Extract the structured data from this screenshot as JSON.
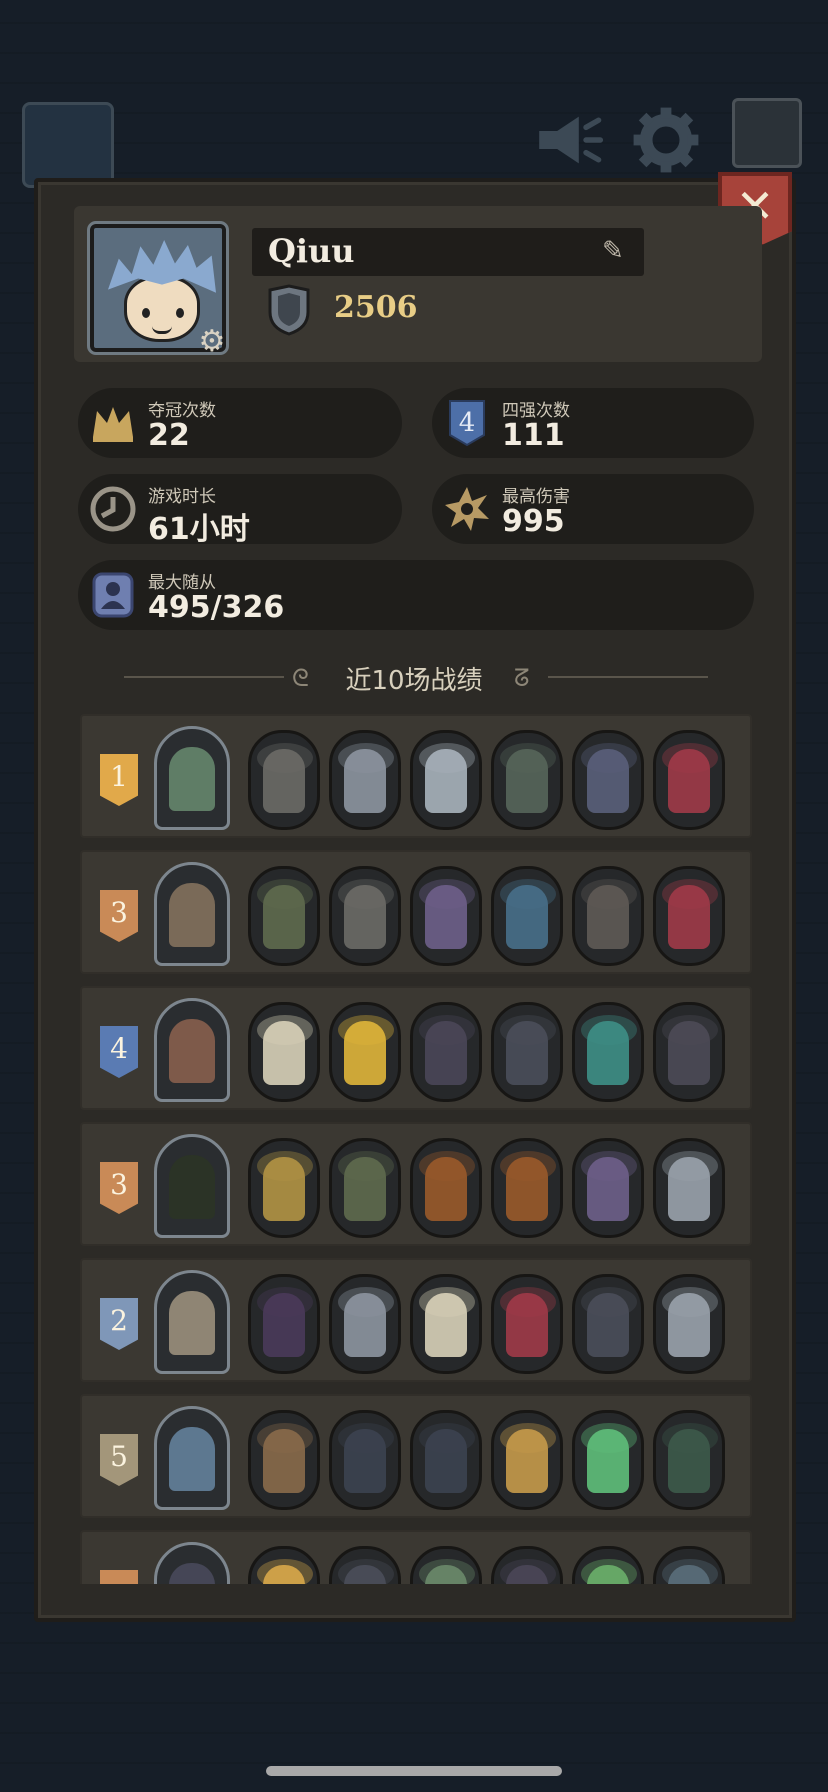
{
  "profile": {
    "name": "Qiuu",
    "rating": "2506"
  },
  "stats": {
    "championships": {
      "label": "夺冠次数",
      "value": "22",
      "icon": "crown-icon"
    },
    "top4": {
      "label": "四强次数",
      "value": "111",
      "icon": "top4-icon"
    },
    "playtime": {
      "label": "游戏时长",
      "value": "61小时",
      "icon": "clock-icon"
    },
    "max_damage": {
      "label": "最高伤害",
      "value": "995",
      "icon": "damage-burst-icon"
    },
    "max_minions": {
      "label": "最大随从",
      "value": "495/326",
      "icon": "minion-icon"
    }
  },
  "history": {
    "title": "近10场战绩",
    "matches": [
      {
        "rank": "1",
        "rank_color": "#e1a94a",
        "hero_color": "#5f7d66",
        "minions": [
          "#6b6a66",
          "#8d95a0",
          "#a9b3bb",
          "#56655a",
          "#5a5f7a",
          "#a03a48"
        ]
      },
      {
        "rank": "3",
        "rank_color": "#c98a57",
        "hero_color": "#7a6a58",
        "minions": [
          "#5f6a4e",
          "#6b6a66",
          "#6e5f8a",
          "#486f8a",
          "#5f5a55",
          "#a03a48"
        ]
      },
      {
        "rank": "4",
        "rank_color": "#5a7bb3",
        "hero_color": "#7e5a4a",
        "minions": [
          "#d8d0b8",
          "#e0b53a",
          "#4a4658",
          "#4a4e5a",
          "#3e8f86",
          "#4c4a56"
        ]
      },
      {
        "rank": "3",
        "rank_color": "#c98a57",
        "hero_color": "#2b3326",
        "minions": [
          "#b39444",
          "#5f6a4e",
          "#9a5a2a",
          "#9a5a2a",
          "#6e5f8a",
          "#9aa2ac"
        ]
      },
      {
        "rank": "2",
        "rank_color": "#7f97b8",
        "hero_color": "#8f8574",
        "minions": [
          "#4a3a5a",
          "#8d95a0",
          "#d8d0b8",
          "#a03a48",
          "#4a4e5a",
          "#9aa2ac"
        ]
      },
      {
        "rank": "5",
        "rank_color": "#a3967a",
        "hero_color": "#5d7890",
        "minions": [
          "#8a6a4a",
          "#3c4250",
          "#3c4250",
          "#c79a4a",
          "#5fbf7a",
          "#3d5a4a"
        ]
      },
      {
        "rank": "",
        "rank_color": "#c98a57",
        "hero_color": "#454656",
        "minions": [
          "#d8a94a",
          "#4a4e5a",
          "#6a8a6a",
          "#4a4658",
          "#6ab06a",
          "#5a6e7a"
        ]
      }
    ]
  },
  "colors": {
    "panel": "#2c2a26",
    "close_button": "#a7433a",
    "rating_gold": "#e8cd86"
  }
}
